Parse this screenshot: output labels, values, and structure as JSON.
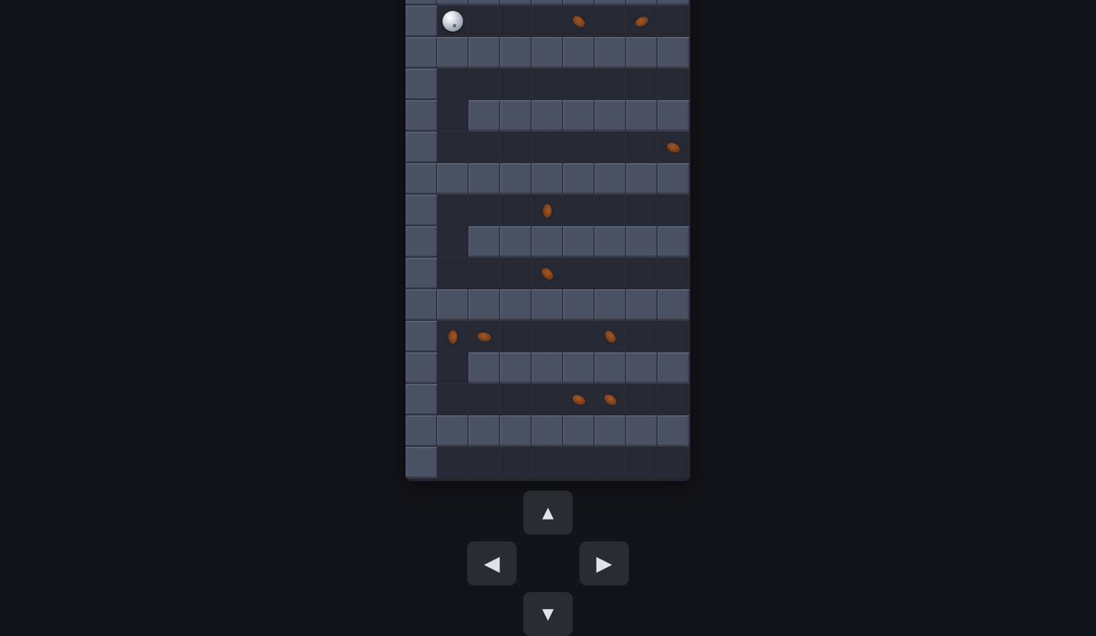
{
  "game": {
    "grid_cols": 9,
    "grid_rows": 16,
    "map": [
      "#########",
      "#.......~",
      "#########",
      "#.......~",
      "#.#######",
      "#.......~",
      "#########",
      "#.......~",
      "#.#######",
      "#.......~",
      "#########",
      "#.......~",
      "#.#######",
      "#.......~",
      "#########",
      "#.......~"
    ],
    "ball": {
      "row": 1,
      "col": 1
    },
    "roaches": [
      {
        "row": 1,
        "col": 5,
        "angle": 40
      },
      {
        "row": 1,
        "col": 7,
        "angle": -25
      },
      {
        "row": 5,
        "col": 8,
        "angle": 25
      },
      {
        "row": 7,
        "col": 4,
        "angle": 90
      },
      {
        "row": 9,
        "col": 4,
        "angle": 45
      },
      {
        "row": 11,
        "col": 1,
        "angle": 90
      },
      {
        "row": 11,
        "col": 2,
        "angle": 10
      },
      {
        "row": 11,
        "col": 6,
        "angle": 55
      },
      {
        "row": 13,
        "col": 5,
        "angle": 25
      },
      {
        "row": 13,
        "col": 6,
        "angle": 35
      }
    ],
    "colors": {
      "background": "#131419",
      "floor": "#262933",
      "wall": "#4a5163",
      "roach": "#7a3e18",
      "button": "#2a2c33"
    }
  },
  "controls": {
    "up": {
      "label": "▲",
      "icon": "arrow-up-icon"
    },
    "left": {
      "label": "◀",
      "icon": "arrow-left-icon"
    },
    "right": {
      "label": "▶",
      "icon": "arrow-right-icon"
    },
    "down": {
      "label": "▼",
      "icon": "arrow-down-icon"
    }
  }
}
